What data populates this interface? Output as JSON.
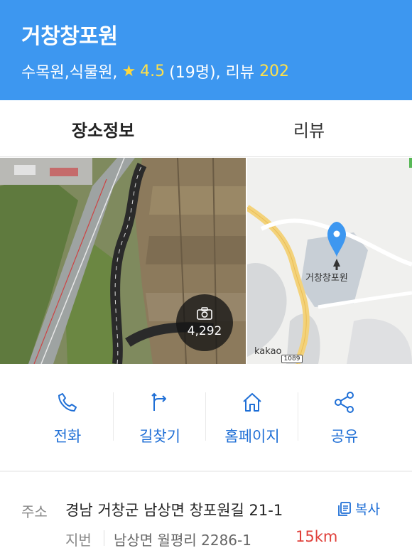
{
  "header": {
    "title": "거창창포원",
    "category": "수목원,식물원,",
    "rating": "4.5",
    "rating_count": "(19명),",
    "review_label": "리뷰",
    "review_count": "202",
    "colors": {
      "background": "#3d97f0",
      "star": "#ffd83b"
    }
  },
  "tabs": [
    {
      "label": "장소정보",
      "active": true
    },
    {
      "label": "리뷰",
      "active": false
    }
  ],
  "media": {
    "photo_count": "4,292",
    "map_place_label": "거창창포원",
    "map_provider": "kakao",
    "road_number": "1089"
  },
  "actions": [
    {
      "label": "전화",
      "icon": "phone-icon"
    },
    {
      "label": "길찾기",
      "icon": "directions-icon"
    },
    {
      "label": "홈페이지",
      "icon": "home-icon"
    },
    {
      "label": "공유",
      "icon": "share-icon"
    }
  ],
  "info": {
    "address_key": "주소",
    "address": "경남 거창군 남상면 창포원길 21-1",
    "copy_label": "복사",
    "lot_key": "지번",
    "lot_address": "남상면 월평리 2286-1",
    "distance": "15km",
    "accent": "#1f6fd6",
    "distance_color": "#e0403a"
  }
}
